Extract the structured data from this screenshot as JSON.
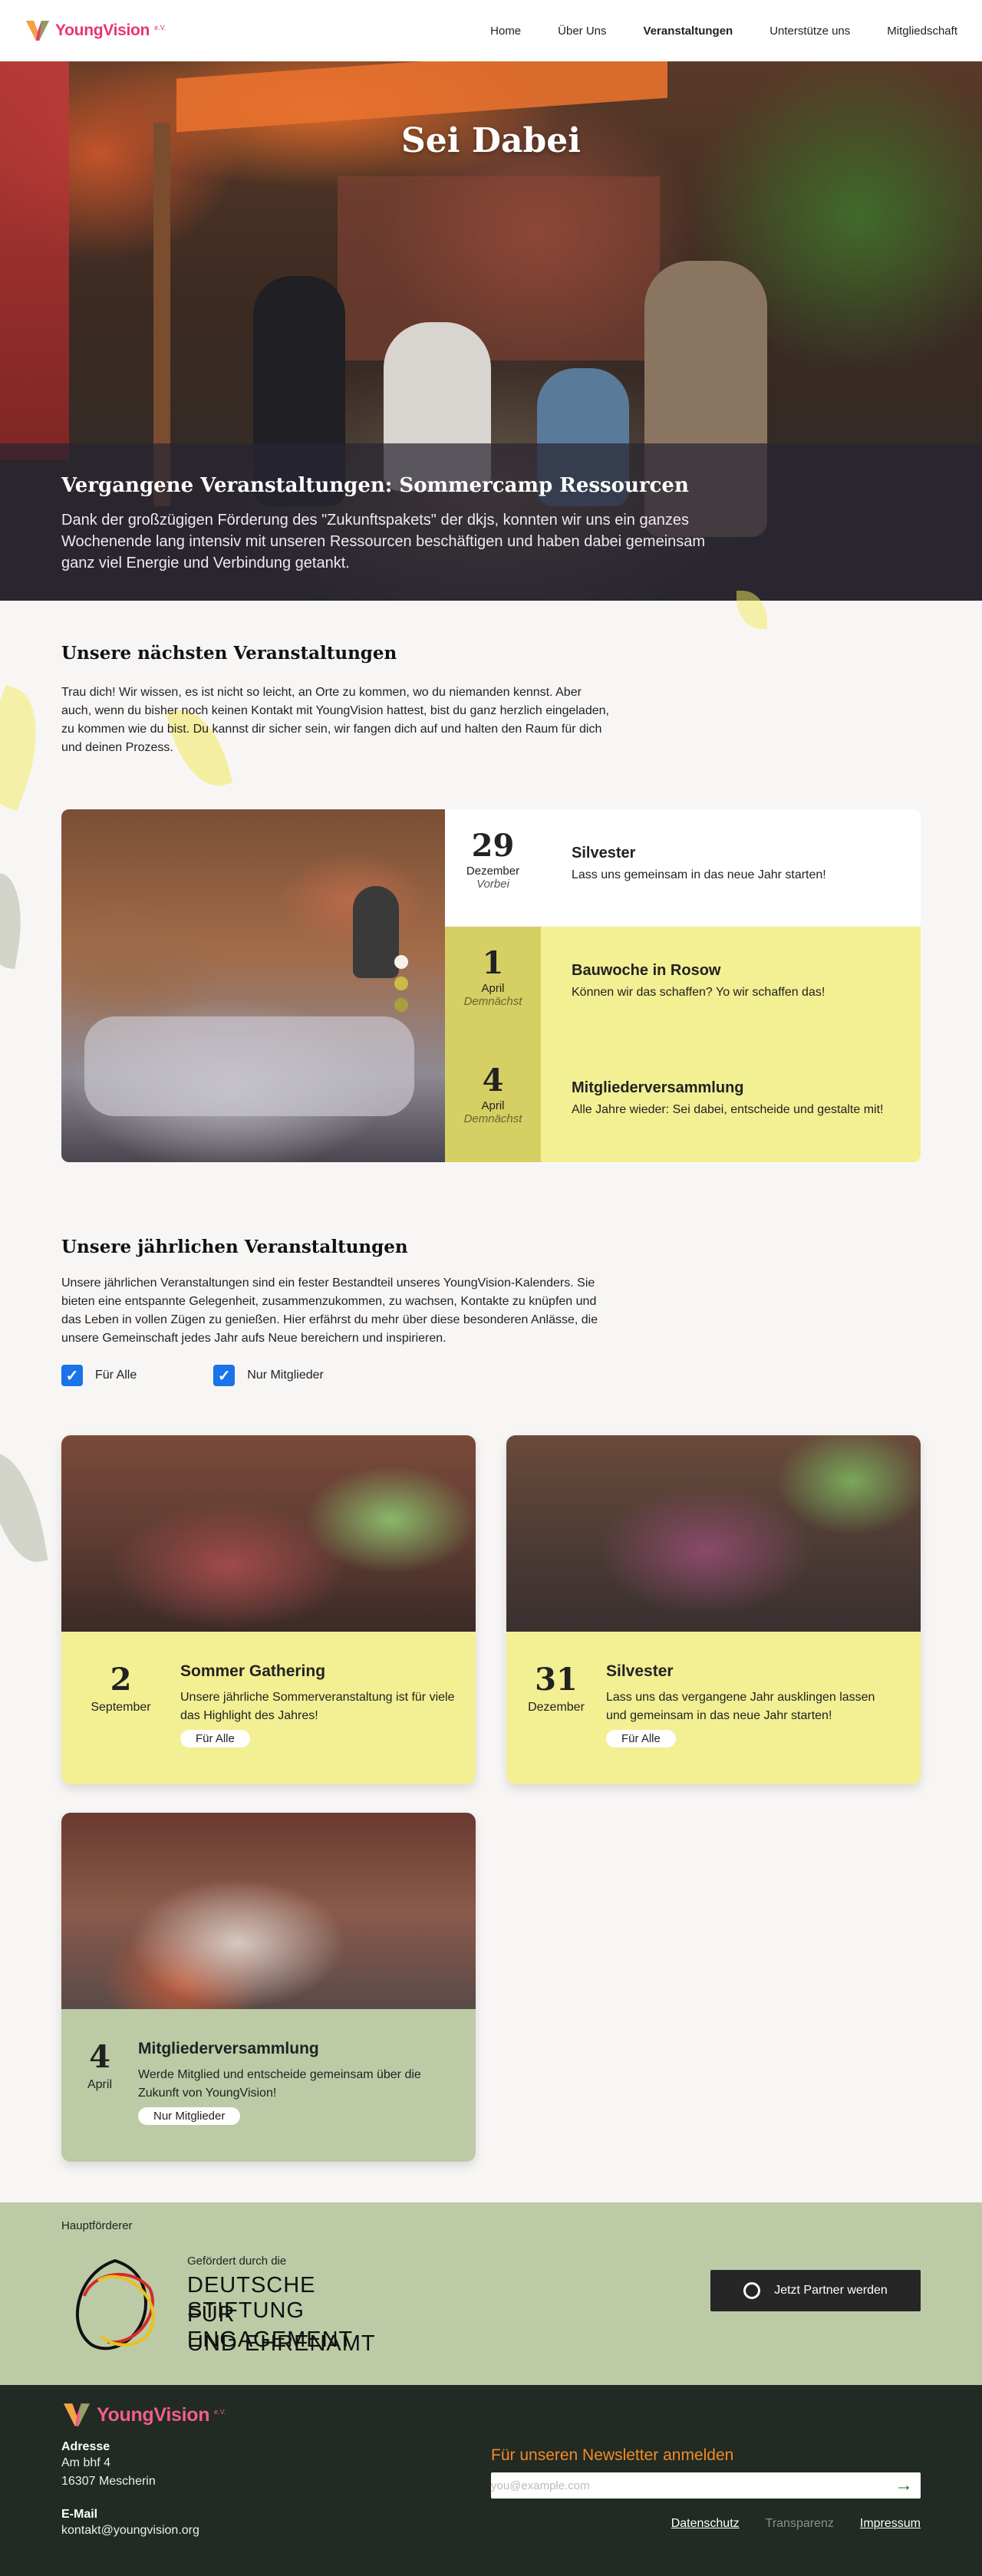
{
  "header": {
    "logo_text": "YoungVision",
    "logo_suffix": "e.V.",
    "nav": [
      "Home",
      "Über Uns",
      "Veranstaltungen",
      "Unterstütze uns",
      "Mitgliedschaft"
    ]
  },
  "hero": {
    "title": "Sei Dabei",
    "subtitle": "Vergangene Veranstaltungen: Sommercamp Ressourcen",
    "text": "Dank der großzügigen Förderung des \"Zukunftspakets\" der dkjs, konnten wir uns ein ganzes Wochenende lang intensiv mit unseren Ressourcen beschäftigen und haben dabei gemeinsam ganz viel Energie und Verbindung getankt."
  },
  "next_events": {
    "title": "Unsere nächsten Veranstaltungen",
    "text": "Trau dich! Wir wissen, es ist nicht so leicht, an Orte zu kommen, wo du niemanden kennst. Aber auch, wenn du bisher noch keinen Kontakt mit YoungVision hattest, bist du ganz herzlich eingeladen, zu kommen wie du bist. Du kannst dir sicher sein, wir fangen dich auf und halten den Raum für dich und deinen Prozess.",
    "items": [
      {
        "day": "29",
        "month": "Dezember",
        "status": "Vorbei",
        "title": "Silvester",
        "desc": "Lass uns gemeinsam in das neue Jahr starten!"
      },
      {
        "day": "1",
        "month": "April",
        "status": "Demnächst",
        "title": "Bauwoche in Rosow",
        "desc": "Können wir das schaffen? Yo wir schaffen das!"
      },
      {
        "day": "4",
        "month": "April",
        "status": "Demnächst",
        "title": "Mitgliederversammlung",
        "desc": "Alle Jahre wieder: Sei dabei, entscheide und gestalte mit!"
      }
    ]
  },
  "annual_events": {
    "title": "Unsere jährlichen Veranstaltungen",
    "text": "Unsere jährlichen Veranstaltungen sind ein fester Bestandteil unseres YoungVision-Kalenders. Sie bieten eine entspannte Gelegenheit, zusammenzukommen, zu wachsen, Kontakte zu knüpfen und das Leben in vollen Zügen zu genießen. Hier erfährst du mehr über diese besonderen Anlässe, die unsere Gemeinschaft jedes Jahr aufs Neue bereichern und inspirieren.",
    "filters": [
      "Für Alle",
      "Nur Mitglieder"
    ],
    "cards": [
      {
        "day": "2",
        "month": "September",
        "title": "Sommer Gathering",
        "desc": "Unsere jährliche Sommerveranstaltung ist für viele das Highlight des Jahres!",
        "tag": "Für Alle"
      },
      {
        "day": "31",
        "month": "Dezember",
        "title": "Silvester",
        "desc": "Lass uns das vergangene Jahr ausklingen lassen und gemeinsam in das neue Jahr starten!",
        "tag": "Für Alle"
      },
      {
        "day": "4",
        "month": "April",
        "title": "Mitgliederversammlung",
        "desc": "Werde Mitglied und entscheide gemeinsam über die Zukunft von YoungVision!",
        "tag": "Nur Mitglieder"
      }
    ]
  },
  "sponsor": {
    "label": "Hauptförderer",
    "funded_by": "Gefördert durch die",
    "name_lines": [
      "DEUTSCHE STIFTUNG",
      "FÜR ENGAGEMENT",
      "UND EHRENAMT"
    ],
    "button": "Jetzt Partner werden"
  },
  "footer": {
    "address_label": "Adresse",
    "address_lines": [
      "Am bhf 4",
      "16307 Mescherin"
    ],
    "email_label": "E-Mail",
    "email": "kontakt@youngvision.org",
    "newsletter_title": "Für unseren Newsletter anmelden",
    "newsletter_placeholder": "you@example.com",
    "links": [
      "Datenschutz",
      "Transparenz",
      "Impressum"
    ]
  },
  "colors": {
    "brand_pink": "#e9356f",
    "yellow": "#f3ef93",
    "sage": "#bccba6",
    "footer_dark": "#212a23",
    "newsletter_orange": "#f28a2a",
    "checkbox_blue": "#1a73e8"
  }
}
